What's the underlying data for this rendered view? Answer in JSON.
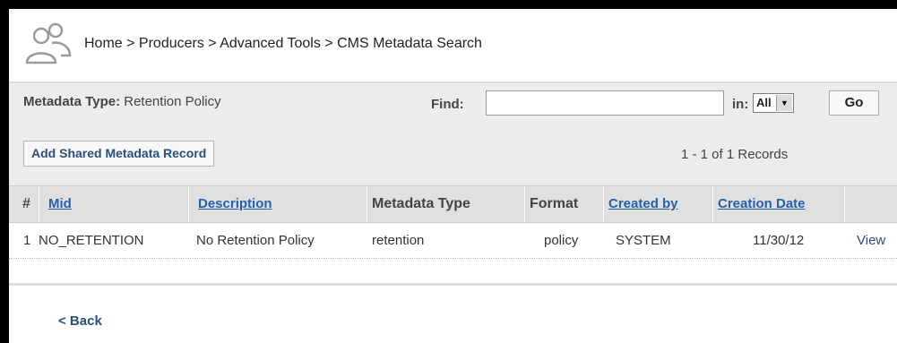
{
  "header": {
    "breadcrumb": "Home > Producers > Advanced Tools > CMS Metadata Search"
  },
  "search": {
    "metadata_type_label": "Metadata Type:",
    "metadata_type_value": "Retention Policy",
    "find_label": "Find:",
    "find_value": "",
    "in_label": "in:",
    "in_selected": "All",
    "go_label": "Go"
  },
  "actions": {
    "add_label": "Add Shared Metadata Record",
    "records_count": "1 - 1 of 1 Records"
  },
  "table": {
    "headers": {
      "num": "#",
      "mid": "Mid",
      "description": "Description",
      "metadata_type": "Metadata Type",
      "format": "Format",
      "created_by": "Created by",
      "creation_date": "Creation Date"
    },
    "rows": [
      {
        "num": "1",
        "mid": "NO_RETENTION",
        "description": "No Retention Policy",
        "metadata_type": "retention",
        "format": "policy",
        "created_by": "SYSTEM",
        "creation_date": "11/30/12",
        "action": "View"
      }
    ]
  },
  "footer": {
    "back_label": "< Back"
  },
  "colors": {
    "link": "#2860a8",
    "header_bg": "#e0e0e0",
    "panel_bg": "#ececec"
  },
  "icons": {
    "logo": "people-icon",
    "select_arrow": "chevron-down-icon"
  }
}
